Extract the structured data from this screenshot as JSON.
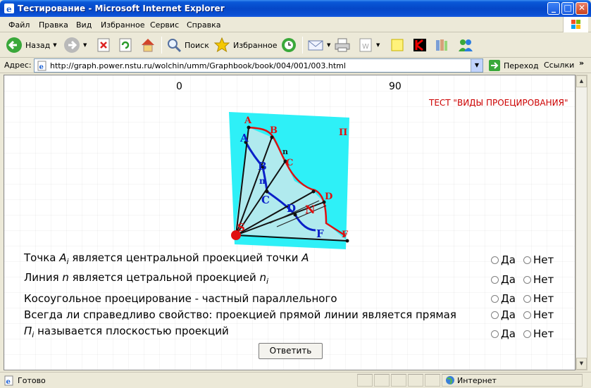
{
  "window": {
    "title": "Тестирование - Microsoft Internet Explorer"
  },
  "menu": [
    "Файл",
    "Правка",
    "Вид",
    "Избранное",
    "Сервис",
    "Справка"
  ],
  "toolbar": {
    "back": "Назад",
    "search": "Поиск",
    "favorites": "Избранное"
  },
  "address": {
    "label": "Адрес:",
    "url": "http://graph.power.nstu.ru/wolchin/umm/Graphbook/book/004/001/003.html",
    "go": "Переход",
    "links": "Ссылки"
  },
  "page": {
    "ruler_start": "0",
    "ruler_end": "90",
    "test_title": "ТЕСТ \"ВИДЫ ПРОЕЦИРОВАНИЯ\"",
    "figure_labels": {
      "plane": "П",
      "A1": "A",
      "B1": "B",
      "n1": "n",
      "C1": "C",
      "D1": "D",
      "F1": "F",
      "A": "A",
      "B": "B",
      "n": "n",
      "C": "C",
      "D": "D",
      "N": "N",
      "F": "F",
      "S": "S",
      "sub": "i"
    },
    "questions": [
      {
        "parts": [
          "Точка ",
          "A",
          "i",
          " является центральной проекцией точки ",
          "A"
        ]
      },
      {
        "parts": [
          "Линия ",
          "n",
          "",
          " является цетральной проекцией ",
          "n",
          "i"
        ]
      },
      {
        "text": "Косоугольное проецирование - частный параллельного"
      },
      {
        "text": "Всегда ли справедливо свойство: проекцией прямой линии является прямая"
      },
      {
        "parts": [
          "П",
          "i",
          " называется плоскостью проекций"
        ]
      }
    ],
    "option_yes": "Да",
    "option_no": "Нет",
    "submit": "Ответить"
  },
  "status": {
    "text": "Готово",
    "zone": "Интернет"
  },
  "colors": {
    "plane": "#2ef0f7",
    "accent_red": "#cc0000",
    "projection_blue": "#0a20c8"
  }
}
